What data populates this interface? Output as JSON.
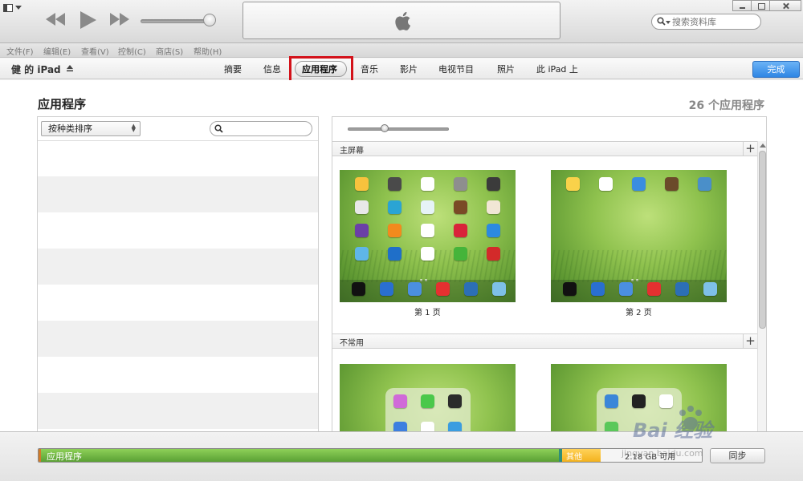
{
  "menubar": {
    "items": [
      "文件(F)",
      "编辑(E)",
      "查看(V)",
      "控制(C)",
      "商店(S)",
      "帮助(H)"
    ]
  },
  "search": {
    "placeholder": "搜索资料库"
  },
  "device": {
    "name": "健 的 iPad",
    "tabs": [
      "摘要",
      "信息",
      "应用程序",
      "音乐",
      "影片",
      "电视节目",
      "照片",
      "此 iPad 上"
    ],
    "active_tab": "应用程序",
    "done_label": "完成"
  },
  "apps": {
    "title": "应用程序",
    "count_label": "26 个应用程序",
    "sort_label": "按种类排序",
    "sections": [
      {
        "label": "主屏幕",
        "pages": [
          "第 1 页",
          "第 2 页"
        ]
      },
      {
        "label": "不常用"
      }
    ]
  },
  "capacity": {
    "apps_label": "应用程序",
    "other_label": "其他",
    "free_label": "2.18 GB 可用",
    "sync_label": "同步"
  },
  "watermark": {
    "brand": "Bai 经验",
    "url": "jingyan.baidu.com"
  },
  "colors": {
    "accent_blue": "#2f86e4",
    "highlight_red": "#d3121a",
    "apps_green": "#5aa034",
    "other_yellow": "#f3b21e"
  }
}
